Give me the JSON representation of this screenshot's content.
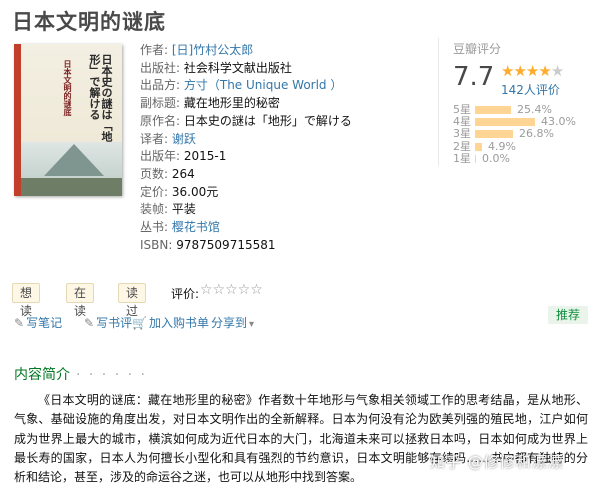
{
  "page_title": "日本文明的谜底",
  "cover": {
    "main_title_vertical": "日本史の謎は「地形」で解ける",
    "subtitle_vertical": "日本文明的谜底"
  },
  "info": [
    {
      "label": "作者:",
      "value": "[日]竹村公太郎",
      "link": true
    },
    {
      "label": "出版社:",
      "value": "社会科学文献出版社",
      "link": false
    },
    {
      "label": "出品方:",
      "value": "方寸（The Unique World ）",
      "link": true
    },
    {
      "label": "副标题:",
      "value": "藏在地形里的秘密",
      "link": false
    },
    {
      "label": "原作名:",
      "value": "日本史の謎は「地形」で解ける",
      "link": false
    },
    {
      "label": "译者:",
      "value": "谢跃",
      "link": true
    },
    {
      "label": "出版年:",
      "value": "2015-1",
      "link": false
    },
    {
      "label": "页数:",
      "value": "264",
      "link": false
    },
    {
      "label": "定价:",
      "value": "36.00元",
      "link": false
    },
    {
      "label": "装帧:",
      "value": "平装",
      "link": false
    },
    {
      "label": "丛书:",
      "value": "樱花书馆",
      "link": true
    },
    {
      "label": "ISBN:",
      "value": "9787509715581",
      "link": false
    }
  ],
  "rating": {
    "title": "豆瓣评分",
    "score": "7.7",
    "stars_filled": 4,
    "stars_total": 5,
    "count_text": "142人评价",
    "bars": [
      {
        "label": "5星",
        "pct_text": "25.4%",
        "value": 25.4
      },
      {
        "label": "4星",
        "pct_text": "43.0%",
        "value": 43.0
      },
      {
        "label": "3星",
        "pct_text": "26.8%",
        "value": 26.8
      },
      {
        "label": "2星",
        "pct_text": "4.9%",
        "value": 4.9
      },
      {
        "label": "1星",
        "pct_text": "0.0%",
        "value": 0.0
      }
    ]
  },
  "actions": {
    "want_read": "想读",
    "reading": "在读",
    "read": "读过",
    "rate_label": "评价:",
    "rate_stars": "☆☆☆☆☆"
  },
  "tools": {
    "write_note": "写笔记",
    "write_review": "写书评",
    "add_cart": "加入购书单",
    "share": "分享到",
    "share_arrow": "▾",
    "recommend": "推荐"
  },
  "intro": {
    "heading": "内容简介",
    "dots": "· · · · · ·",
    "text": "《日本文明的谜底：藏在地形里的秘密》作者数十年地形与气象相关领域工作的思考结晶，是从地形、气象、基础设施的角度出发，对日本文明作出的全新解释。日本为何没有沦为欧美列强的殖民地，江户如何成为世界上最大的城市，横滨如何成为近代日本的大门，北海道未来可以拯救日本吗，日本如何成为世界上最长寿的国家，日本人为何擅长小型化和具有强烈的节约意识，日本文明能够存续吗……书中都有独特的分析和结论，甚至，涉及的命运谷之迷，也可以从地形中找到答案。"
  },
  "watermark": "知乎 @修修和漂漂"
}
